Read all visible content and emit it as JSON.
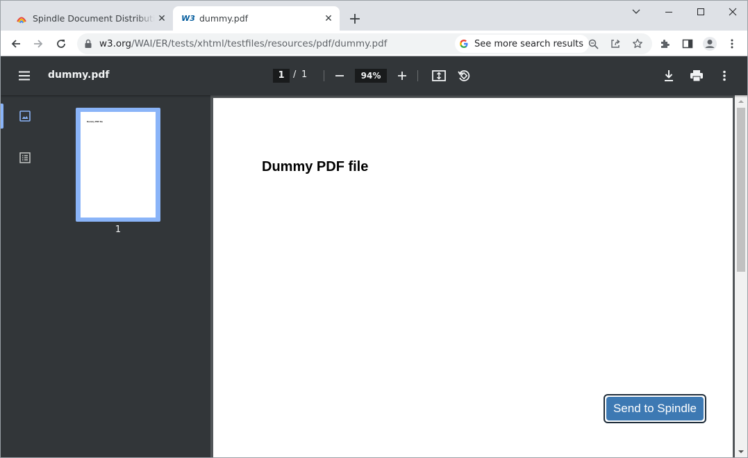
{
  "browser": {
    "tabs": [
      {
        "title": "Spindle Document Distribution -",
        "icon": "spindle-favicon",
        "active": false
      },
      {
        "title": "dummy.pdf",
        "icon": "w3c-favicon",
        "favicon_text": "W3",
        "active": true
      }
    ],
    "address": {
      "host": "w3.org",
      "path": "/WAI/ER/tests/xhtml/testfiles/resources/pdf/dummy.pdf"
    },
    "search_chip": "See more search results"
  },
  "pdf_viewer": {
    "title": "dummy.pdf",
    "current_page": "1",
    "page_separator": "/",
    "total_pages": "1",
    "zoom": "94%",
    "thumbnail_page_number": "1",
    "thumbnail_text": "Dummy PDF file",
    "page_heading": "Dummy PDF file"
  },
  "overlay": {
    "send_button": "Send to Spindle"
  },
  "colors": {
    "pdf_toolbar": "#323639",
    "pdf_background": "#525659",
    "accent_blue": "#8ab4f8",
    "spindle_button": "#3d79b3",
    "tabstrip": "#dee1e6"
  }
}
